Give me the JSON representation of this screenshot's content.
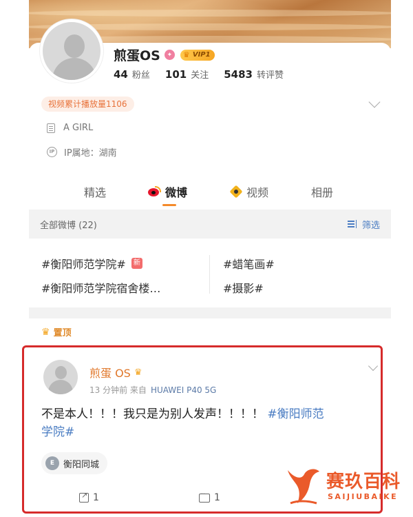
{
  "profile": {
    "username": "煎蛋OS",
    "vip_label": "VIP1",
    "stats": [
      {
        "value": "44",
        "label": "粉丝"
      },
      {
        "value": "101",
        "label": "关注"
      },
      {
        "value": "5483",
        "label": "转评赞"
      }
    ],
    "play_count_tag": "视频累计播放量1106",
    "bio": "A GIRL",
    "ip_location": "IP属地：湖南"
  },
  "tabs": [
    {
      "label": "精选"
    },
    {
      "label": "微博",
      "active": true
    },
    {
      "label": "视频"
    },
    {
      "label": "相册"
    }
  ],
  "filter_bar": {
    "all_label": "全部微博 (22)",
    "filter_label": "筛选"
  },
  "topics": [
    {
      "label": "#衡阳师范学院#",
      "new_badge": "新"
    },
    {
      "label": "#蜡笔画#"
    },
    {
      "label": "#衡阳师范学院宿舍楼…"
    },
    {
      "label": "#摄影#"
    }
  ],
  "pinned_label": "置顶",
  "post": {
    "author": "煎蛋 OS",
    "time": "13 分钟前",
    "source_prefix": "来自",
    "source": "HUAWEI P40 5G",
    "text": "不是本人！！！我只是为别人发声！！！！",
    "hashtag_part1": "#衡阳师范",
    "hashtag_part2": "学院#",
    "location": "衡阳同城",
    "share_count": "1",
    "comment_count": "1"
  },
  "watermark": {
    "title": "赛玖百科",
    "subtitle": "SAIJIUBAIKE"
  },
  "colors": {
    "accent_orange": "#e0772a",
    "link_blue": "#4a7cc2",
    "highlight_red": "#d62b2b"
  }
}
